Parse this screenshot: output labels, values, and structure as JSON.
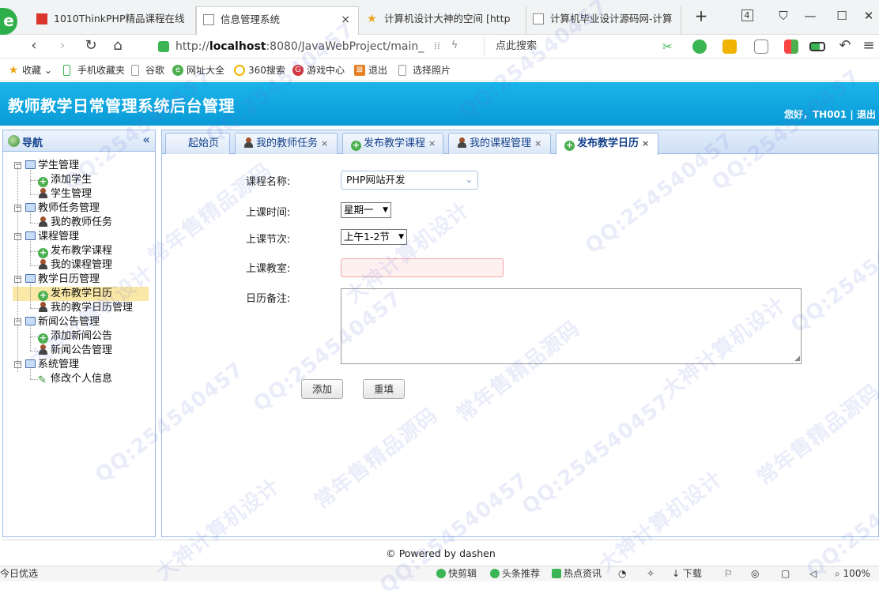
{
  "browser": {
    "tabs": [
      {
        "title": "1010ThinkPHP精品课程在线"
      },
      {
        "title": "信息管理系统"
      },
      {
        "title": "计算机设计大神的空间 [http"
      },
      {
        "title": "计算机毕业设计源码网-计算"
      }
    ],
    "new_tab": "+",
    "tab_count": "4",
    "url_prefix": "http://",
    "url_host": "localhost",
    "url_rest": ":8080/JavaWebProject/main_",
    "search_placeholder": "点此搜索",
    "close_glyph": "×"
  },
  "bookmarks": [
    {
      "label": "收藏"
    },
    {
      "label": "手机收藏夹"
    },
    {
      "label": "谷歌"
    },
    {
      "label": "网址大全"
    },
    {
      "label": "360搜索"
    },
    {
      "label": "游戏中心"
    },
    {
      "label": "退出"
    },
    {
      "label": "选择照片"
    }
  ],
  "app": {
    "title": "教师教学日常管理系统后台管理",
    "user_info": "您好，TH001 | 退出"
  },
  "nav": {
    "title": "导航",
    "collapse_glyph": "«",
    "groups": [
      {
        "label": "学生管理",
        "items": [
          "添加学生",
          "学生管理"
        ]
      },
      {
        "label": "教师任务管理",
        "items": [
          "我的教师任务"
        ]
      },
      {
        "label": "课程管理",
        "items": [
          "发布教学课程",
          "我的课程管理"
        ]
      },
      {
        "label": "教学日历管理",
        "items": [
          "发布教学日历",
          "我的教学日历管理"
        ]
      },
      {
        "label": "新闻公告管理",
        "items": [
          "添加新闻公告",
          "新闻公告管理"
        ]
      },
      {
        "label": "系统管理",
        "items": [
          "修改个人信息"
        ]
      }
    ],
    "selected": "发布教学日历"
  },
  "content_tabs": [
    {
      "label": "起始页"
    },
    {
      "label": "我的教师任务"
    },
    {
      "label": "发布教学课程"
    },
    {
      "label": "我的课程管理"
    },
    {
      "label": "发布教学日历"
    }
  ],
  "form": {
    "course_label": "课程名称:",
    "course_value": "PHP网站开发",
    "time_label": "上课时间:",
    "time_value": "星期一",
    "period_label": "上课节次:",
    "period_value": "上午1-2节",
    "room_label": "上课教室:",
    "room_value": "",
    "remark_label": "日历备注:",
    "remark_value": "",
    "add_button": "添加",
    "reset_button": "重填"
  },
  "footer": {
    "text": "© Powered by dashen"
  },
  "statusbar": {
    "left": "今日优选",
    "items": [
      "快剪辑",
      "头条推荐",
      "热点资讯",
      "下载"
    ],
    "zoom": "100%"
  },
  "watermarks": [
    "QQ:254540457",
    "常年售精品源码",
    "大神计算机设计"
  ]
}
